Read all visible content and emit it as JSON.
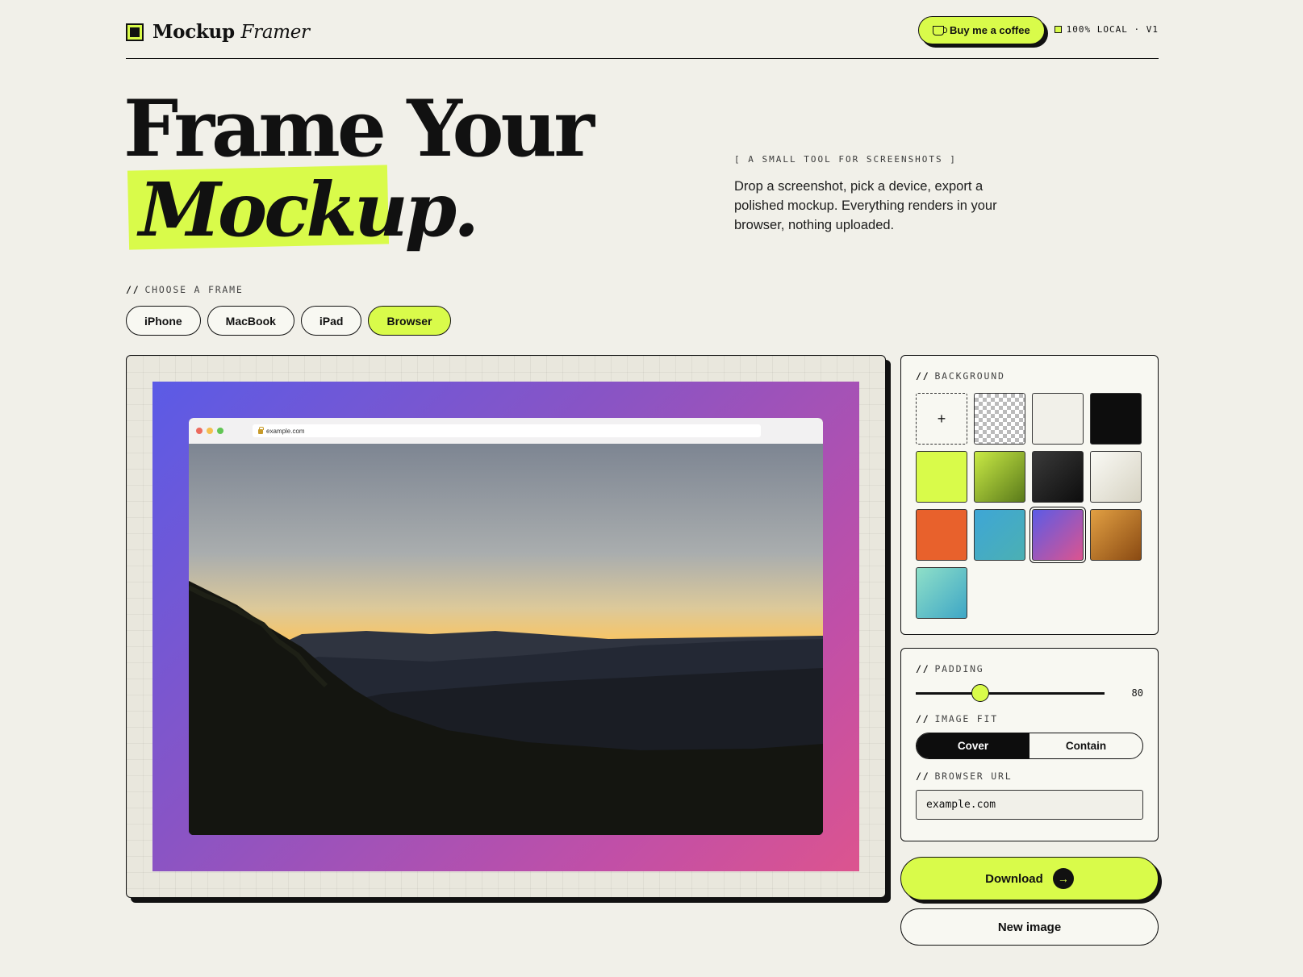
{
  "brand": {
    "name": "Mockup",
    "name_italic": "Framer",
    "coffee_label": "Buy me a coffee",
    "badge": "100% LOCAL · V1"
  },
  "hero": {
    "line1": "Frame Your",
    "line2": "Mockup.",
    "tagline": "[ A SMALL TOOL FOR SCREENSHOTS ]",
    "lead": "Drop a screenshot, pick a device, export a polished mockup. Everything renders in your browser, nothing uploaded."
  },
  "frame_chooser": {
    "prefix": "//",
    "label": "CHOOSE A FRAME",
    "options": [
      "iPhone",
      "MacBook",
      "iPad",
      "Browser"
    ],
    "selected": "Browser"
  },
  "preview": {
    "url": "example.com",
    "traffic_light_colors": [
      "#ec6a5e",
      "#f4bf4f",
      "#61c554"
    ],
    "background_gradient": [
      "#5b5be6",
      "#8a54c4",
      "#c14fa7",
      "#dc548f"
    ]
  },
  "background": {
    "prefix": "//",
    "label": "BACKGROUND",
    "add_label": "+",
    "swatches": [
      "add",
      "transparent",
      "cream",
      "black",
      "lime",
      "olive-gradient",
      "charcoal-gradient",
      "pearl-gradient",
      "orange",
      "ocean-gradient",
      "violet-pink-gradient",
      "copper-gradient",
      "mint-gradient"
    ],
    "selected": "violet-pink-gradient"
  },
  "padding": {
    "prefix": "//",
    "label": "PADDING",
    "value": "80",
    "level_fraction": 0.34
  },
  "image_fit": {
    "prefix": "//",
    "label": "IMAGE FIT",
    "options": [
      "Cover",
      "Contain"
    ],
    "selected": "Cover"
  },
  "browser_url": {
    "prefix": "//",
    "label": "BROWSER URL",
    "value": "example.com"
  },
  "actions": {
    "download": "Download",
    "new_image": "New image"
  },
  "colors": {
    "accent": "#d9fb4a",
    "ink": "#111111",
    "page_bg": "#f1f0e9"
  }
}
